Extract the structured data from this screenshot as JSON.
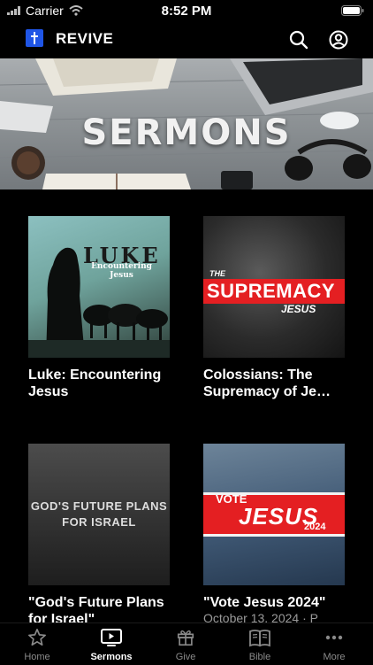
{
  "status_bar": {
    "carrier": "Carrier",
    "time": "8:52 PM"
  },
  "header": {
    "app_name": "REVIVE",
    "logo_icon": "cross-logo-icon",
    "accent_color": "#1f55e6"
  },
  "hero": {
    "title": "SERMONS"
  },
  "series": [
    {
      "title": "Luke: Encountering Jesus",
      "art_title": "LUKE",
      "art_subtitle": "Encountering Jesus"
    },
    {
      "title": "Colossians: The Supremacy of Je…",
      "art_kicker": "THE",
      "art_title": "SUPREMACY",
      "art_subtitle": "JESUS"
    },
    {
      "title": "\"God's Future Plans for Israel\"",
      "art_title_line1": "GOD'S FUTURE PLANS",
      "art_title_line2": "FOR ISRAEL"
    },
    {
      "title": "\"Vote Jesus 2024\"",
      "date": "October 13, 2024 · P",
      "art_kicker": "VOTE",
      "art_title": "JESUS",
      "art_subtitle": "2024"
    }
  ],
  "tabs": [
    {
      "label": "Home",
      "icon": "star-icon",
      "active": false
    },
    {
      "label": "Sermons",
      "icon": "play-screen-icon",
      "active": true
    },
    {
      "label": "Give",
      "icon": "gift-icon",
      "active": false
    },
    {
      "label": "Bible",
      "icon": "book-icon",
      "active": false
    },
    {
      "label": "More",
      "icon": "ellipsis-icon",
      "active": false
    }
  ]
}
